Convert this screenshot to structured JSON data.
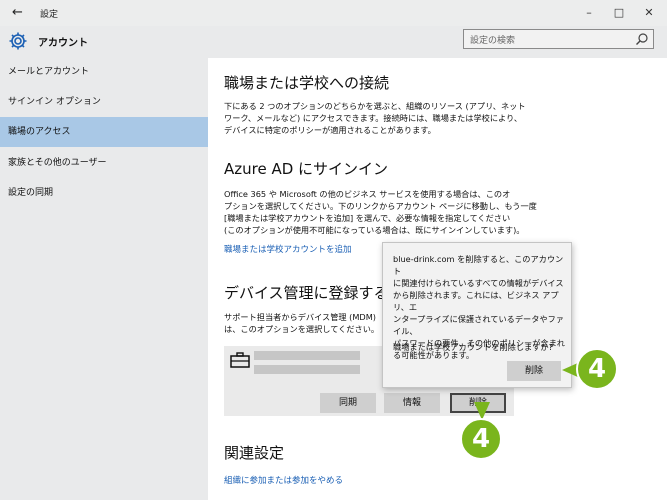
{
  "window": {
    "back_icon": "arrow-left-icon",
    "title": "設定",
    "minimize": "–",
    "maximize": "□",
    "close": "✕"
  },
  "header": {
    "app_title": "アカウント",
    "search_placeholder": "設定の検索"
  },
  "sidebar": {
    "items": [
      {
        "label": "メールとアカウント",
        "active": false
      },
      {
        "label": "サインイン オプション",
        "active": false
      },
      {
        "label": "職場のアクセス",
        "active": true
      },
      {
        "label": "家族とその他のユーザー",
        "active": false
      },
      {
        "label": "設定の同期",
        "active": false
      }
    ]
  },
  "main": {
    "section1": {
      "title": "職場または学校への接続",
      "lines": [
        "下にある 2 つのオプションのどちらかを選ぶと、組織のリソース (アプリ、ネット",
        "ワーク、メールなど) にアクセスできます。接続時には、職場または学校により、",
        "デバイスに特定のポリシーが適用されることがあります。"
      ]
    },
    "section2": {
      "title": "Azure AD にサインイン",
      "lines": [
        "Office 365 や Microsoft の他のビジネス サービスを使用する場合は、このオ",
        "プションを選択してください。下のリンクからアカウント ページに移動し、もう一度",
        "[職場または学校アカウントを追加] を選んで、必要な情報を指定してください",
        "(このオプションが使用不可能になっている場合は、既にサインインしています)。"
      ],
      "link": "職場または学校アカウントを追加"
    },
    "section3": {
      "title": "デバイス管理に登録する",
      "lines": [
        "サポート担当者からデバイス管理 (MDM)",
        "は、このオプションを選択してください。"
      ],
      "buttons": {
        "sync": "同期",
        "info": "情報",
        "delete": "削除"
      }
    },
    "section4": {
      "title": "関連設定",
      "link": "組織に参加または参加をやめる"
    }
  },
  "flyout": {
    "lines": [
      "blue-drink.com を削除すると、このアカウント",
      "に関連付けられているすべての情報がデバイス",
      "から削除されます。これには、ビジネス アプリ、エ",
      "ンタープライズに保護されているデータやファイル、",
      "パスワードの要件、その他のポリシーが含まれ",
      "る可能性があります。"
    ],
    "question": "職場または学校アカウントを削除しますか?",
    "confirm": "削除"
  },
  "callouts": {
    "step_a": "4",
    "step_b": "4"
  },
  "colors": {
    "accent_link": "#1a5fb4",
    "nav_active": "#a9c8e6",
    "callout": "#7ab51d"
  }
}
